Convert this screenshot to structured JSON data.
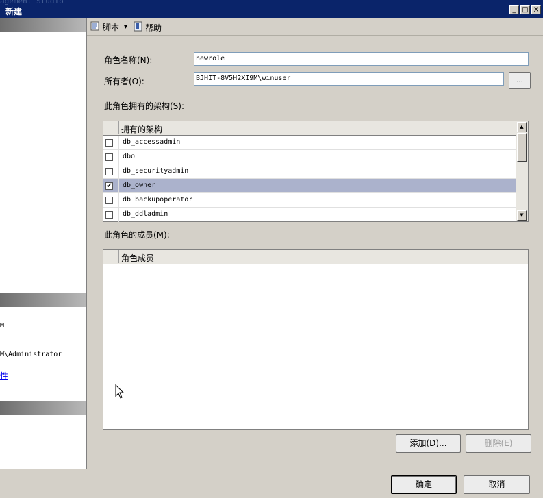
{
  "window": {
    "ghost_text": "agement Studio",
    "title": "新建",
    "minimize_glyph": "_",
    "maximize_glyph": "□",
    "close_glyph": "X"
  },
  "left_pane": {
    "server_fragment": "M",
    "user_fragment": "M\\Administrator",
    "link_fragment": "性"
  },
  "toolbar": {
    "script_label": "脚本",
    "dropdown_glyph": "▾",
    "help_label": "帮助"
  },
  "form": {
    "role_name_label": "角色名称(N):",
    "role_name_value": "newrole",
    "owner_label": "所有者(O):",
    "owner_value": "BJHIT-8V5H2XI9M\\winuser",
    "browse_label": "...",
    "schemas_label": "此角色拥有的架构(S):",
    "members_label": "此角色的成员(M):"
  },
  "schemas_grid": {
    "column_header": "拥有的架构",
    "rows": [
      {
        "name": "db_accessadmin",
        "checked": false,
        "check_glyph": ""
      },
      {
        "name": "dbo",
        "checked": false,
        "check_glyph": ""
      },
      {
        "name": "db_securityadmin",
        "checked": false,
        "check_glyph": ""
      },
      {
        "name": "db_owner",
        "checked": true,
        "check_glyph": "✔"
      },
      {
        "name": "db_backupoperator",
        "checked": false,
        "check_glyph": ""
      },
      {
        "name": "db_ddladmin",
        "checked": false,
        "check_glyph": ""
      }
    ],
    "scroll_up_glyph": "▲",
    "scroll_down_glyph": "▼"
  },
  "members_grid": {
    "column_header": "角色成员"
  },
  "buttons": {
    "add_label": "添加(D)...",
    "remove_label": "删除(E)",
    "ok_label": "确定",
    "cancel_label": "取消"
  },
  "colors": {
    "title_bar": "#0a246a",
    "selected_row": "#abb2cc"
  }
}
